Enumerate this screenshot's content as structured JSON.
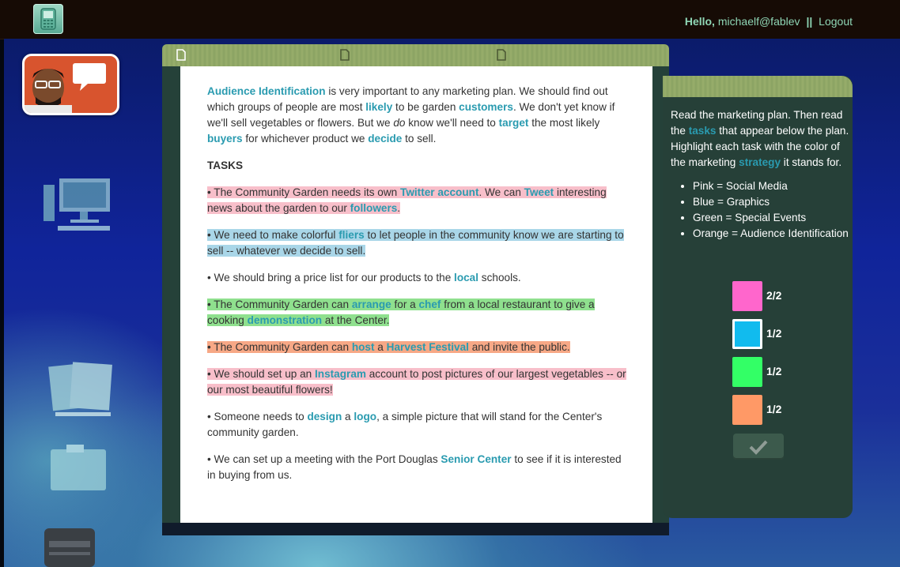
{
  "header": {
    "hello": "Hello,",
    "email": "michaelf@fablev",
    "separator": "||",
    "logout": "Logout"
  },
  "document": {
    "intro": [
      {
        "t": "Audience Identification",
        "kw": true
      },
      {
        "t": " is very important to any marketing plan. We should find out which groups of people are most "
      },
      {
        "t": "likely",
        "kw": true
      },
      {
        "t": " to be garden "
      },
      {
        "t": "customers",
        "kw": true
      },
      {
        "t": ". We don't yet know if we'll sell vegetables or flowers. But we "
      },
      {
        "t": "do",
        "it": true
      },
      {
        "t": " know we'll need to "
      },
      {
        "t": "target",
        "kw": true
      },
      {
        "t": " the most likely "
      },
      {
        "t": "buyers",
        "kw": true
      },
      {
        "t": " for whichever product we "
      },
      {
        "t": "decide",
        "kw": true
      },
      {
        "t": " to sell."
      }
    ],
    "tasks_heading": "TASKS",
    "tasks": [
      {
        "highlight": "pink",
        "parts": [
          {
            "t": "• The Community Garden needs its own "
          },
          {
            "t": "Twitter account",
            "kw": true
          },
          {
            "t": ". We can "
          },
          {
            "t": "Tweet",
            "kw": true
          },
          {
            "t": " interesting news about the garden to our "
          },
          {
            "t": "followers",
            "kw": true
          },
          {
            "t": "."
          }
        ]
      },
      {
        "highlight": "blue",
        "parts": [
          {
            "t": "• We need to make colorful "
          },
          {
            "t": "fliers",
            "kw": true
          },
          {
            "t": " to let people in the community know we are starting to sell -- whatever we decide to sell."
          }
        ]
      },
      {
        "highlight": "none",
        "parts": [
          {
            "t": "• We should bring a price list for our products to the "
          },
          {
            "t": "local",
            "kw": true
          },
          {
            "t": " schools."
          }
        ]
      },
      {
        "highlight": "green",
        "parts": [
          {
            "t": "• The Community Garden can "
          },
          {
            "t": "arrange",
            "kw": true
          },
          {
            "t": " for a "
          },
          {
            "t": "chef",
            "kw": true
          },
          {
            "t": " from a local restaurant to give a cooking "
          },
          {
            "t": "demonstration",
            "kw": true
          },
          {
            "t": " at the Center."
          }
        ]
      },
      {
        "highlight": "orange",
        "parts": [
          {
            "t": "• The Community Garden can "
          },
          {
            "t": "host",
            "kw": true
          },
          {
            "t": " a "
          },
          {
            "t": "Harvest Festival",
            "kw": true
          },
          {
            "t": " and invite the public."
          }
        ]
      },
      {
        "highlight": "pink",
        "parts": [
          {
            "t": "• We should set up an "
          },
          {
            "t": "Instagram",
            "kw": true
          },
          {
            "t": " account to post pictures of our largest vegetables -- or our most beautiful flowers!"
          }
        ]
      },
      {
        "highlight": "none",
        "parts": [
          {
            "t": "• Someone needs to "
          },
          {
            "t": "design",
            "kw": true
          },
          {
            "t": " a "
          },
          {
            "t": "logo",
            "kw": true
          },
          {
            "t": ", a simple picture that will stand for the Center's community garden."
          }
        ]
      },
      {
        "highlight": "none",
        "parts": [
          {
            "t": "• We can set up a meeting with the Port Douglas "
          },
          {
            "t": "Senior Center",
            "kw": true
          },
          {
            "t": " to see if it is interested in buying from us."
          }
        ]
      }
    ]
  },
  "sidebar": {
    "instructions": [
      {
        "t": "Read the marketing plan. Then read the "
      },
      {
        "t": "tasks",
        "kw": true
      },
      {
        "t": " that appear below the plan. Highlight each task with the color of the marketing "
      },
      {
        "t": "strategy",
        "kw": true
      },
      {
        "t": " it stands for."
      }
    ],
    "legend": [
      "Pink = Social Media",
      "Blue = Graphics",
      "Green = Special Events",
      "Orange = Audience Identification"
    ],
    "swatches": [
      {
        "name": "pink",
        "color": "#ff66cc",
        "count": "2/2",
        "selected": false
      },
      {
        "name": "blue",
        "color": "#11bbee",
        "count": "1/2",
        "selected": true
      },
      {
        "name": "green",
        "color": "#33ff66",
        "count": "1/2",
        "selected": false
      },
      {
        "name": "orange",
        "color": "#ff9966",
        "count": "1/2",
        "selected": false
      }
    ]
  },
  "colors": {
    "keyword": "#2a9bb0",
    "highlight_pink": "#f8bfca",
    "highlight_blue": "#a9d6e8",
    "highlight_green": "#8fe08e",
    "highlight_orange": "#f7a886"
  },
  "icons": {
    "phone": "phone-icon",
    "chat": "chat-bubble-icon",
    "document_tab": "document-icon",
    "check": "check-icon"
  }
}
